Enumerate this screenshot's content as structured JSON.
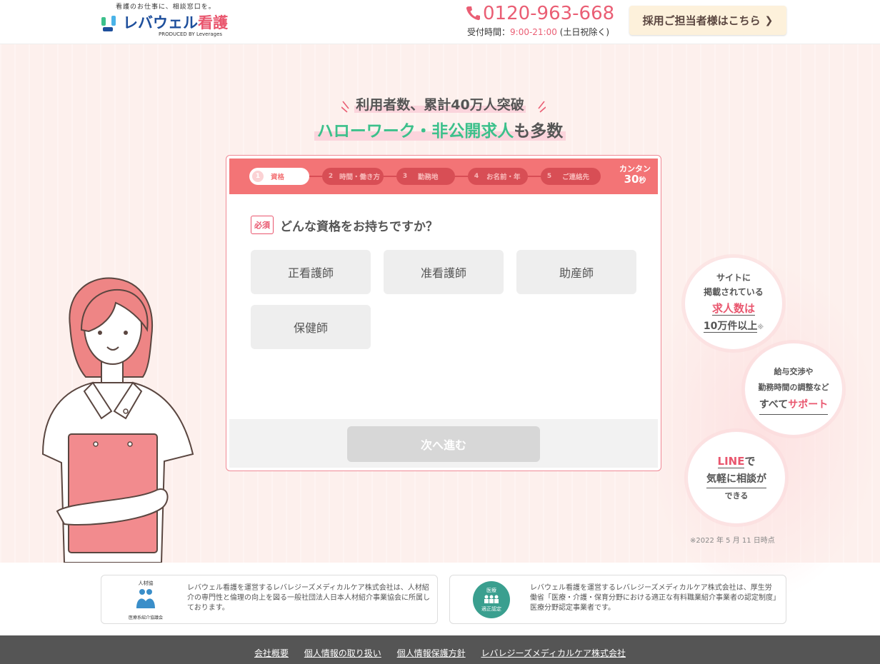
{
  "header": {
    "tagline": "看護のお仕事に、相談窓口を。",
    "logo_main": "レバウェル",
    "logo_accent": "看護",
    "logo_sub": "PRODUCED BY Leverages",
    "phone": "0120-963-668",
    "hours_label": "受付時間：",
    "hours_time": "9:00-21:00",
    "hours_note": "(土日祝除く)",
    "recruit_button": "採用ご担当者様はこちら"
  },
  "hero": {
    "headline1": "利用者数、累計40万人突破",
    "headline2_green": "ハローワーク・非公開求人",
    "headline2_rest": "も多数"
  },
  "form": {
    "steps": [
      {
        "num": "1",
        "label": "資格"
      },
      {
        "num": "2",
        "label": "時間・働き方"
      },
      {
        "num": "3",
        "label": "勤務地"
      },
      {
        "num": "4",
        "label": "お名前・年"
      },
      {
        "num": "5",
        "label": "ご連絡先"
      }
    ],
    "kantan_label": "カンタン",
    "kantan_sec_num": "30",
    "kantan_sec_unit": "秒",
    "required_label": "必須",
    "question": "どんな資格をお持ちですか？",
    "options": [
      "正看護師",
      "准看護師",
      "助産師",
      "保健師"
    ],
    "next_button": "次へ進む"
  },
  "badges": {
    "b1_line1": "サイトに",
    "b1_line2": "掲載されている",
    "b1_line3": "求人数は",
    "b1_line4": "10万件以上",
    "b1_mark": "※",
    "b2_line1": "給与交渉や",
    "b2_line2": "勤務時間の調整など",
    "b2_line3a": "すべて",
    "b2_line3b": "サポート",
    "b3_line1a": "LINE",
    "b3_line1b": "で",
    "b3_line2": "気軽に相談が",
    "b3_line3": "できる",
    "note": "※2022 年 5 月 11 日時点"
  },
  "certs": {
    "c1_logo_top": "人材協",
    "c1_logo_bottom": "医療系紹介協議会",
    "c1_text": "レバウェル看護を運営するレバレジーズメディカルケア株式会社は、人材紹介の専門性と倫理の向上を図る一般社団法人日本人材紹介事業協会に所属しております。",
    "c2_logo_top": "医療",
    "c2_logo_bottom": "適正認定",
    "c2_text": "レバウェル看護を運営するレバレジーズメディカルケア株式会社は、厚生労働省「医療・介護・保育分野における適正な有料職業紹介事業者の認定制度」医療分野認定事業者です。"
  },
  "footer": {
    "links": [
      "会社概要",
      "個人情報の取り扱い",
      "個人情報保護方針",
      "レバレジーズメディカルケア株式会社"
    ]
  },
  "colors": {
    "accent_pink": "#ea5e74",
    "step_bar": "#f37476",
    "green": "#3cc08b",
    "brand_blue": "#1e4f9c"
  }
}
